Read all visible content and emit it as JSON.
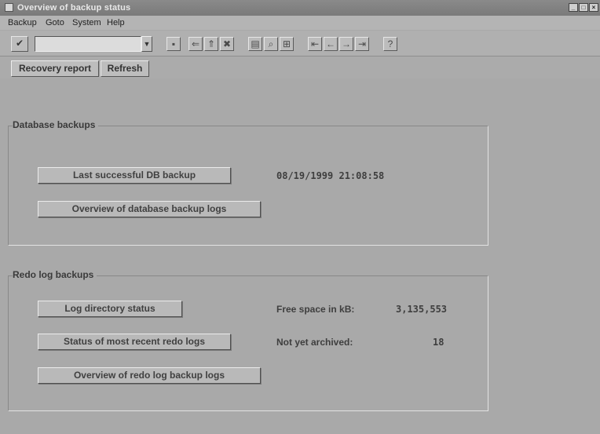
{
  "window": {
    "title": "Overview of backup status"
  },
  "menu": [
    "Backup",
    "Goto",
    "System",
    "Help"
  ],
  "toolbar": {
    "command_value": ""
  },
  "app_toolbar": {
    "recovery_report": "Recovery report",
    "refresh": "Refresh"
  },
  "database_backups": {
    "title": "Database backups",
    "last_successful_button": "Last successful DB backup",
    "last_successful_value": "08/19/1999 21:08:58",
    "overview_logs_button": "Overview of database backup logs"
  },
  "redo_log_backups": {
    "title": "Redo log backups",
    "log_dir_button": "Log directory status",
    "free_space_label": "Free space in kB:",
    "free_space_value": "3,135,553",
    "recent_status_button": "Status of most recent redo logs",
    "not_archived_label": "Not yet archived:",
    "not_archived_value": "18",
    "overview_logs_button": "Overview of redo log backup logs"
  }
}
